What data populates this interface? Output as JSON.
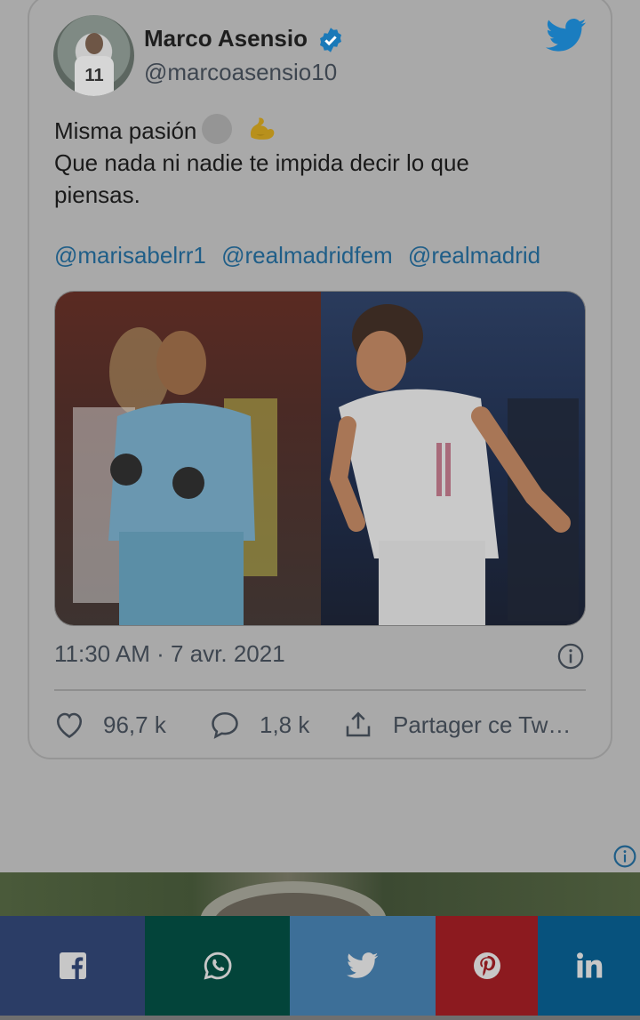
{
  "tweet": {
    "author_name": "Marco Asensio",
    "author_handle": "@marcoasensio10",
    "avatar_number": "11",
    "text_line1": "Misma pasión",
    "text_line2": "Que nada ni nadie te impida decir lo que",
    "text_line3": "piensas.",
    "mentions": [
      "@marisabelrr1",
      "@realmadridfem",
      "@realmadrid"
    ],
    "timestamp": "11:30 AM · 7 avr. 2021",
    "likes": "96,7 k",
    "replies": "1,8 k",
    "share_label": "Partager ce Tw…"
  },
  "icons": {
    "verified": "verified-badge-icon",
    "brand": "twitter-bird-icon",
    "like": "heart-icon",
    "reply": "speech-bubble-icon",
    "share": "share-upload-icon",
    "info": "info-icon",
    "emoji1": "circle-emoji",
    "emoji2": "flexed-biceps-emoji"
  },
  "share_bar": [
    {
      "network": "facebook",
      "color": "#2b3d66"
    },
    {
      "network": "whatsapp",
      "color": "#03443a"
    },
    {
      "network": "twitter",
      "color": "#3d6f98"
    },
    {
      "network": "pinterest",
      "color": "#8c1a1f"
    },
    {
      "network": "linkedin",
      "color": "#07527d"
    }
  ],
  "colors": {
    "overlay_background": "#a9a9a9",
    "link": "#1f5e88",
    "twitter_blue": "#1d8ad6"
  }
}
